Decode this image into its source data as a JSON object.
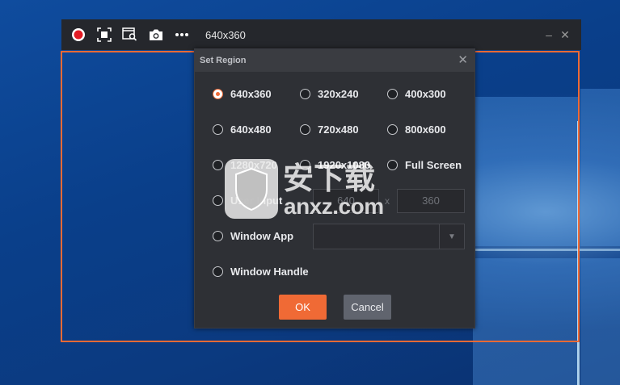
{
  "toolbar": {
    "icons": [
      "record-icon",
      "region-icon",
      "window-search-icon",
      "camera-icon",
      "more-icon"
    ],
    "size_label": "640x360",
    "minimize": "–",
    "close": "✕"
  },
  "dialog": {
    "title": "Set Region",
    "close": "✕",
    "options": [
      {
        "label": "640x360",
        "checked": true
      },
      {
        "label": "320x240",
        "checked": false
      },
      {
        "label": "400x300",
        "checked": false
      },
      {
        "label": "640x480",
        "checked": false
      },
      {
        "label": "720x480",
        "checked": false
      },
      {
        "label": "800x600",
        "checked": false
      },
      {
        "label": "1280x720",
        "checked": false
      },
      {
        "label": "1920x1080",
        "checked": false
      },
      {
        "label": "Full Screen",
        "checked": false
      },
      {
        "label": "User Input",
        "checked": false
      },
      {
        "label": "Window App",
        "checked": false
      },
      {
        "label": "Window Handle",
        "checked": false
      }
    ],
    "user_input": {
      "width": "640",
      "separator": "x",
      "height": "360"
    },
    "window_app_value": "",
    "ok_label": "OK",
    "cancel_label": "Cancel"
  },
  "watermark": {
    "cn": "安下载",
    "text": "anxz.com"
  },
  "colors": {
    "accent": "#f06a35",
    "dialog_bg": "#2e3035",
    "toolbar_bg": "#25272c"
  }
}
